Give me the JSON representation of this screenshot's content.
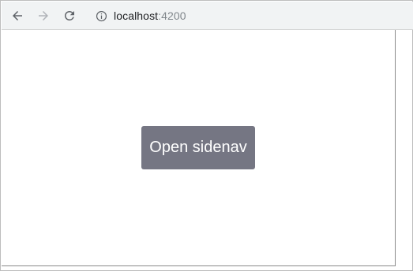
{
  "browser": {
    "url_host": "localhost",
    "url_port": ":4200",
    "icons": {
      "back": "arrow-left-icon",
      "forward": "arrow-right-icon",
      "reload": "reload-icon",
      "site_info": "info-icon"
    }
  },
  "page": {
    "open_button_label": "Open sidenav"
  },
  "colors": {
    "button_bg": "#757683",
    "toolbar_bg": "#f1f3f4"
  }
}
